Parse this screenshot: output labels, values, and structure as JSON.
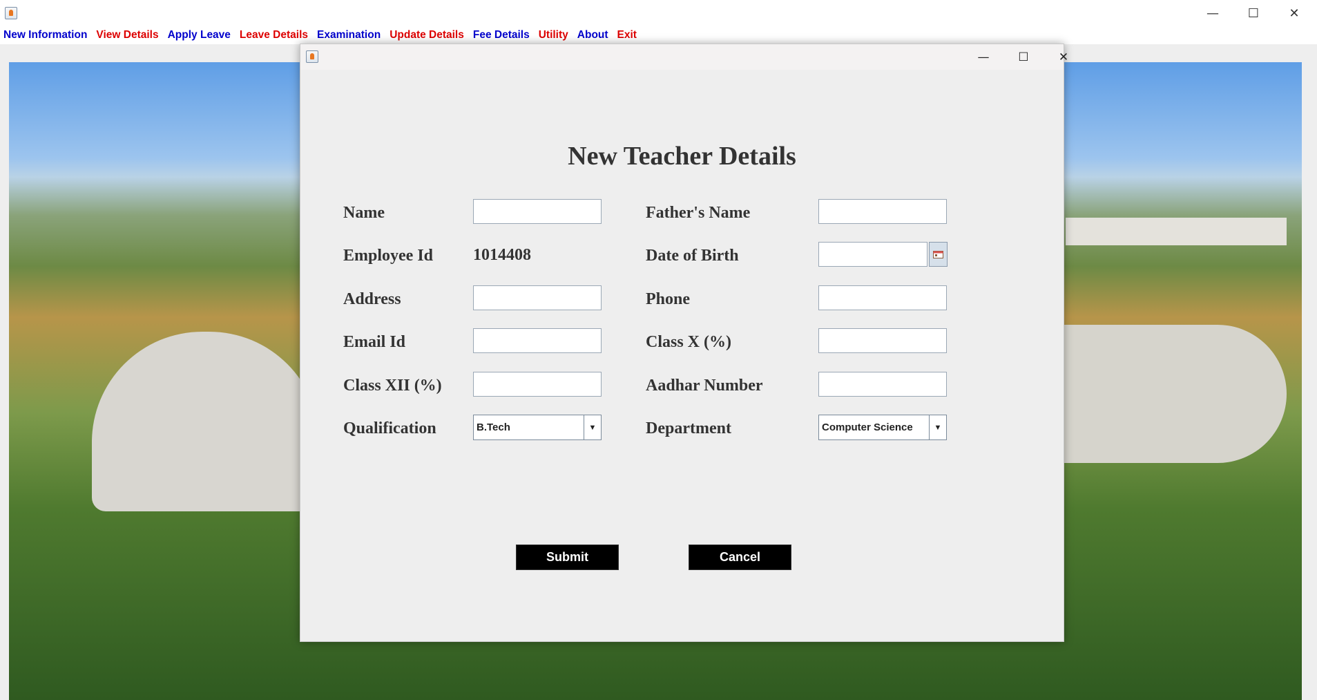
{
  "main_window": {
    "controls": {
      "minimize": "—",
      "maximize": "☐",
      "close": "✕"
    }
  },
  "menu": {
    "items": [
      {
        "label": "New Information",
        "color": "#0000cc"
      },
      {
        "label": "View Details",
        "color": "#dd0000"
      },
      {
        "label": "Apply Leave",
        "color": "#0000cc"
      },
      {
        "label": "Leave Details",
        "color": "#dd0000"
      },
      {
        "label": "Examination",
        "color": "#0000cc"
      },
      {
        "label": "Update Details",
        "color": "#dd0000"
      },
      {
        "label": "Fee Details",
        "color": "#0000cc"
      },
      {
        "label": "Utility",
        "color": "#dd0000"
      },
      {
        "label": "About",
        "color": "#0000cc"
      },
      {
        "label": "Exit",
        "color": "#dd0000"
      }
    ]
  },
  "dialog": {
    "controls": {
      "minimize": "—",
      "maximize": "☐",
      "close": "✕"
    },
    "heading": "New Teacher Details",
    "labels": {
      "name": "Name",
      "fathers_name": "Father's Name",
      "employee_id": "Employee Id",
      "date_of_birth": "Date of Birth",
      "address": "Address",
      "phone": "Phone",
      "email_id": "Email Id",
      "class_x": "Class X (%)",
      "class_xii": "Class XII (%)",
      "aadhar_number": "Aadhar Number",
      "qualification": "Qualification",
      "department": "Department"
    },
    "values": {
      "employee_id": "1014408",
      "name": "",
      "fathers_name": "",
      "date_of_birth": "",
      "address": "",
      "phone": "",
      "email_id": "",
      "class_x": "",
      "class_xii": "",
      "aadhar_number": "",
      "qualification": "B.Tech",
      "department": "Computer Science"
    },
    "buttons": {
      "submit": "Submit",
      "cancel": "Cancel"
    }
  }
}
